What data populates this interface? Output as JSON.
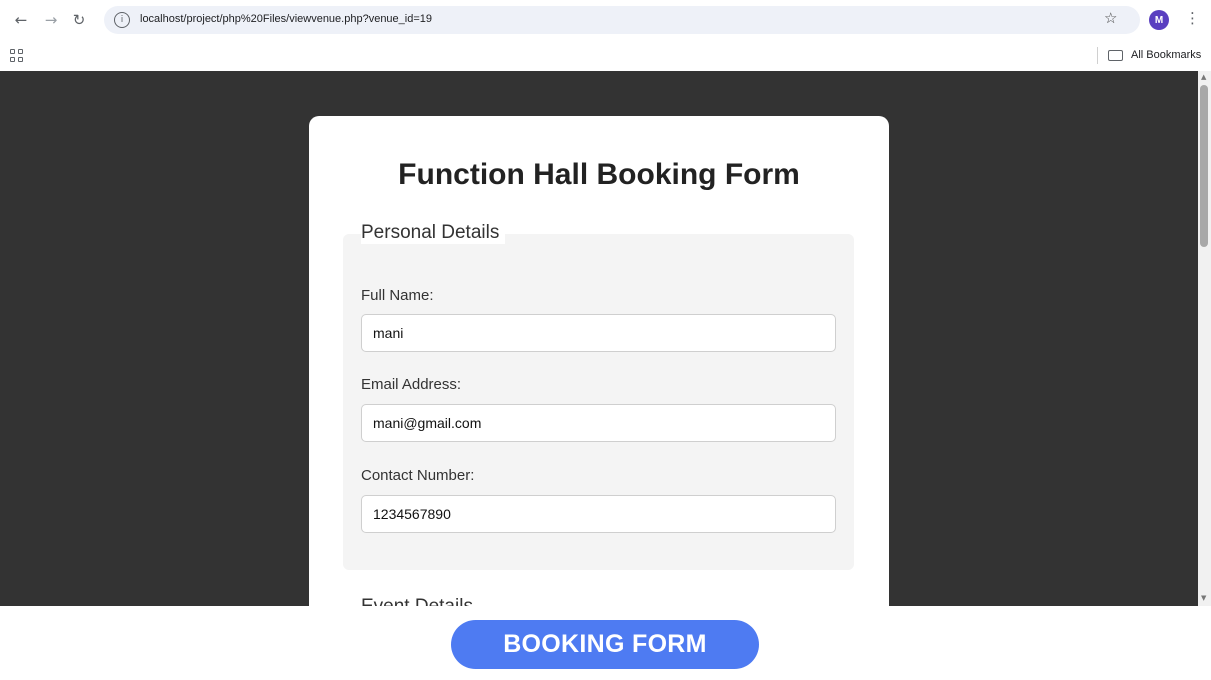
{
  "browser": {
    "url": "localhost/project/php%20Files/viewvenue.php?venue_id=19",
    "avatar_letter": "M",
    "bookmarks_label": "All Bookmarks"
  },
  "form": {
    "title": "Function Hall Booking Form",
    "section_personal": "Personal Details",
    "full_name_label": "Full Name:",
    "full_name_value": "mani",
    "email_label": "Email Address:",
    "email_value": "mani@gmail.com",
    "contact_label": "Contact Number:",
    "contact_value": "1234567890",
    "section_event_partial": "Event Details"
  },
  "caption": "BOOKING FORM",
  "colors": {
    "page_background": "#333333",
    "caption_background": "#4e7bf2",
    "avatar_background": "#5a3fc0"
  },
  "icons": [
    "back-arrow-icon",
    "forward-arrow-icon",
    "reload-icon",
    "site-info-icon",
    "star-icon",
    "menu-dots-icon",
    "apps-grid-icon",
    "folder-icon"
  ]
}
